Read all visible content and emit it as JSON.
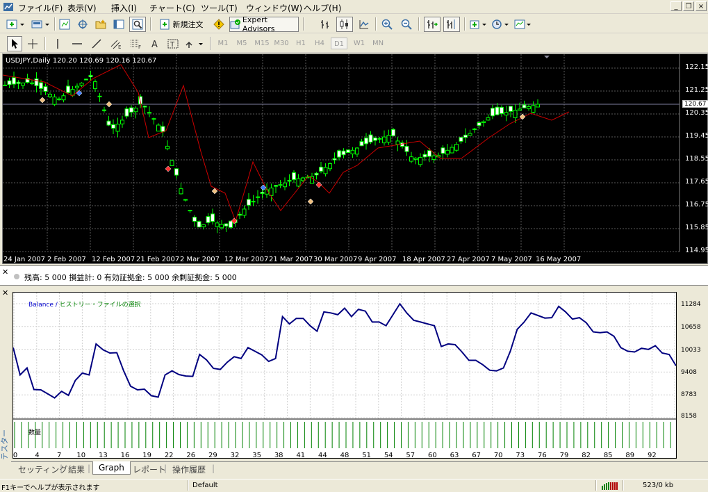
{
  "menu": [
    "ファイル(F)",
    "表示(V)",
    "挿入(I)",
    "チャート(C)",
    "ツール(T)",
    "ウィンドウ(W)",
    "ヘルプ(H)"
  ],
  "toolbar": {
    "new_order": "新規注文",
    "expert_advisors": "Expert Advisors"
  },
  "timeframes": [
    "M1",
    "M5",
    "M15",
    "M30",
    "H1",
    "H4",
    "D1",
    "W1",
    "MN"
  ],
  "active_timeframe": "D1",
  "chart": {
    "label": "USDJPY,Daily  120.20 120.69 120.16 120.67",
    "current_price": "120.67",
    "price_labels": [
      "122.15",
      "121.25",
      "120.35",
      "119.45",
      "118.55",
      "117.65",
      "116.75",
      "115.85",
      "114.95"
    ],
    "date_labels": [
      "24 Jan 2007",
      "2 Feb 2007",
      "12 Feb 2007",
      "21 Feb 2007",
      "2 Mar 2007",
      "12 Mar 2007",
      "21 Mar 2007",
      "30 Mar 2007",
      "9 Apr 2007",
      "18 Apr 2007",
      "27 Apr 2007",
      "7 May 2007",
      "16 May 2007"
    ],
    "colors": {
      "background": "#000000",
      "candle": "#00ff00",
      "line": "#cc0000",
      "grid": "#666666"
    }
  },
  "account": {
    "text": "残高: 5 000   損益計: 0   有効証拠金: 5 000   余剰証拠金: 5 000"
  },
  "tester": {
    "side_label": "テスター",
    "legend_balance": "Balance",
    "legend_sep": " / ",
    "legend_history": "ヒストリー・ファイルの選択",
    "volume_label": "数量",
    "y_labels": [
      "11284",
      "10658",
      "10033",
      "9408",
      "8783",
      "8158"
    ],
    "x_labels": [
      "0",
      "4",
      "7",
      "10",
      "13",
      "16",
      "19",
      "22",
      "26",
      "29",
      "32",
      "35",
      "38",
      "41",
      "44",
      "48",
      "51",
      "54",
      "57",
      "60",
      "63",
      "67",
      "70",
      "73",
      "76",
      "79",
      "82",
      "85",
      "89",
      "92"
    ]
  },
  "chart_data": {
    "type": "line",
    "title": "",
    "series": [
      {
        "name": "Balance",
        "values": [
          10080,
          9330,
          9520,
          8930,
          8920,
          8810,
          8700,
          8880,
          8770,
          9180,
          9380,
          9330,
          10180,
          10020,
          9930,
          9940,
          9440,
          9020,
          8920,
          8940,
          8760,
          8720,
          9330,
          9440,
          9340,
          9300,
          9290,
          9890,
          9740,
          9510,
          9480,
          9680,
          9830,
          9780,
          10080,
          9980,
          9880,
          9700,
          9780,
          10930,
          10730,
          10880,
          10880,
          10680,
          10530,
          11060,
          11030,
          10980,
          11160,
          10930,
          11130,
          11080,
          10780,
          10780,
          10680,
          10980,
          11280,
          11030,
          10830,
          10780,
          10730,
          10680,
          10110,
          10180,
          10160,
          9960,
          9730,
          9730,
          9610,
          9460,
          9440,
          9520,
          9980,
          10580,
          10780,
          11030,
          10960,
          10890,
          10900,
          11210,
          11060,
          10860,
          10900,
          10760,
          10510,
          10490,
          10510,
          10390,
          10080,
          9980,
          9960,
          10060,
          10030,
          10130,
          9930,
          9890,
          9580
        ]
      }
    ],
    "ylim": [
      8158,
      11284
    ],
    "grid": true
  },
  "tabs": [
    "セッティング",
    "結果",
    "Graph",
    "レポート",
    "操作履歴"
  ],
  "active_tab": "Graph",
  "statusbar": {
    "help": "F1キーでヘルプが表示されます",
    "profile": "Default",
    "traffic": "523/0 kb"
  }
}
